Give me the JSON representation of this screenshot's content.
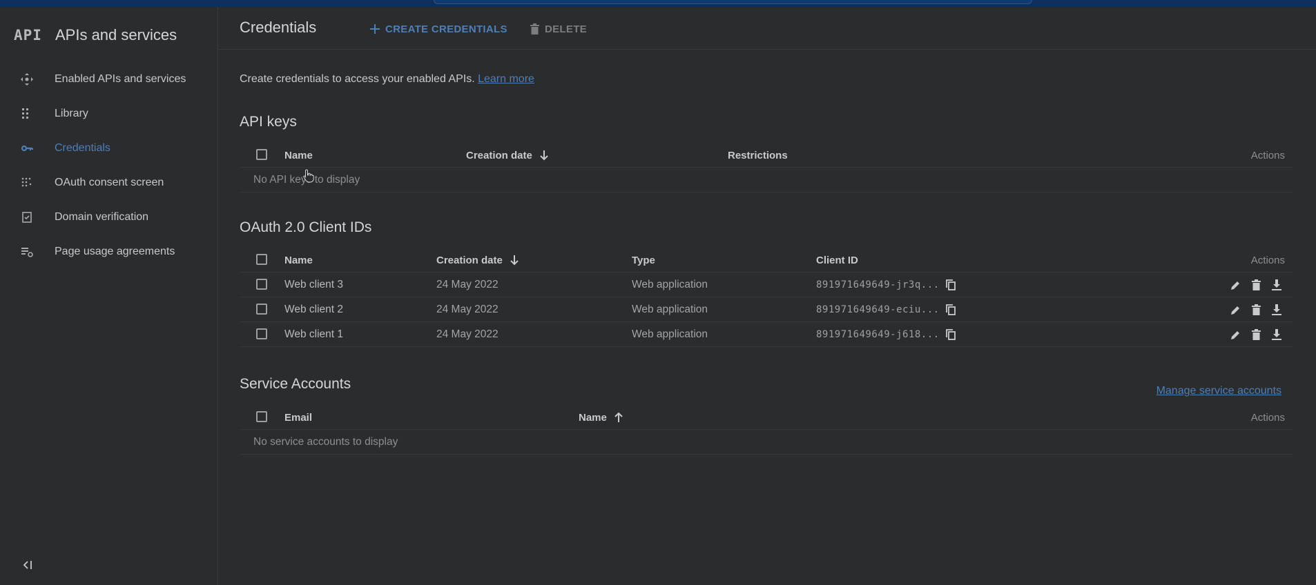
{
  "colors": {
    "background": "#2b2c2e",
    "accent": "#4d7fb8",
    "topbar": "#0c2f5e"
  },
  "sidebar": {
    "logo": "API",
    "title": "APIs and services",
    "items": [
      {
        "label": "Enabled APIs and services",
        "icon": "diamond-arrows-icon",
        "active": false
      },
      {
        "label": "Library",
        "icon": "grid-icon",
        "active": false
      },
      {
        "label": "Credentials",
        "icon": "key-icon",
        "active": true
      },
      {
        "label": "OAuth consent screen",
        "icon": "dots-grid-icon",
        "active": false
      },
      {
        "label": "Domain verification",
        "icon": "checkbox-icon",
        "active": false
      },
      {
        "label": "Page usage agreements",
        "icon": "settings-list-icon",
        "active": false
      }
    ],
    "collapse_icon": "collapse-left-icon"
  },
  "header": {
    "title": "Credentials",
    "create_label": "CREATE CREDENTIALS",
    "delete_label": "DELETE"
  },
  "intro": {
    "text": "Create credentials to access your enabled APIs.",
    "link": "Learn more"
  },
  "api_keys": {
    "title": "API keys",
    "columns": {
      "name": "Name",
      "created": "Creation date",
      "restrictions": "Restrictions",
      "actions": "Actions"
    },
    "empty": "No API keys to display"
  },
  "oauth": {
    "title": "OAuth 2.0 Client IDs",
    "columns": {
      "name": "Name",
      "created": "Creation date",
      "type": "Type",
      "client_id": "Client ID",
      "actions": "Actions"
    },
    "rows": [
      {
        "name": "Web client 3",
        "created": "24 May 2022",
        "type": "Web application",
        "client_id": "891971649649-jr3q..."
      },
      {
        "name": "Web client 2",
        "created": "24 May 2022",
        "type": "Web application",
        "client_id": "891971649649-eciu..."
      },
      {
        "name": "Web client 1",
        "created": "24 May 2022",
        "type": "Web application",
        "client_id": "891971649649-j618..."
      }
    ]
  },
  "service_accounts": {
    "title": "Service Accounts",
    "manage_link": "Manage service accounts",
    "columns": {
      "email": "Email",
      "name": "Name",
      "actions": "Actions"
    },
    "empty": "No service accounts to display"
  }
}
